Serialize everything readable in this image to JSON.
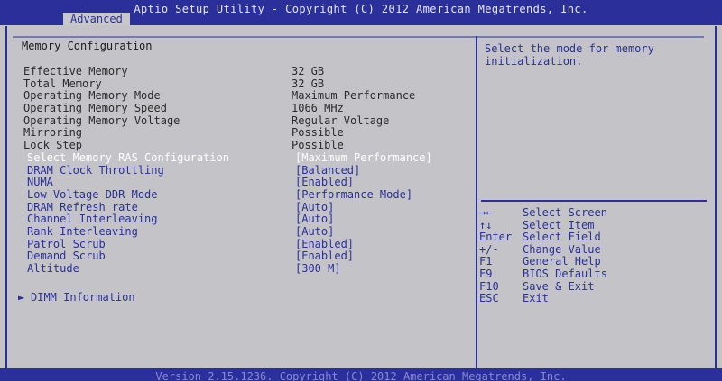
{
  "header": {
    "title": "Aptio Setup Utility - Copyright (C) 2012 American Megatrends, Inc.",
    "active_tab": "Advanced"
  },
  "main": {
    "section_title": "Memory Configuration",
    "rows": [
      {
        "label": "Effective Memory",
        "value": "32 GB"
      },
      {
        "label": "Total Memory",
        "value": "32 GB"
      },
      {
        "label": "Operating Memory Mode",
        "value": "Maximum Performance"
      },
      {
        "label": "Operating Memory Speed",
        "value": "1066 MHz"
      },
      {
        "label": "Operating Memory Voltage",
        "value": "Regular Voltage"
      },
      {
        "label": "Mirroring",
        "value": "Possible"
      },
      {
        "label": "Lock Step",
        "value": "Possible"
      },
      {
        "label": "Select Memory RAS Configuration",
        "value": "[Maximum Performance]"
      },
      {
        "label": "DRAM Clock Throttling",
        "value": "[Balanced]"
      },
      {
        "label": "NUMA",
        "value": "[Enabled]"
      },
      {
        "label": "Low Voltage DDR Mode",
        "value": "[Performance Mode]"
      },
      {
        "label": "DRAM Refresh rate",
        "value": "[Auto]"
      },
      {
        "label": "Channel Interleaving",
        "value": "[Auto]"
      },
      {
        "label": "Rank Interleaving",
        "value": "[Auto]"
      },
      {
        "label": "Patrol Scrub",
        "value": "[Enabled]"
      },
      {
        "label": "Demand Scrub",
        "value": "[Enabled]"
      },
      {
        "label": "Altitude",
        "value": "[300 M]"
      }
    ],
    "submenu": {
      "arrow": "►",
      "label": "DIMM Information"
    }
  },
  "help": {
    "text": "Select the mode for memory initialization.",
    "keys": [
      {
        "key": "→←",
        "desc": "Select Screen"
      },
      {
        "key": "↑↓",
        "desc": "Select Item"
      },
      {
        "key": "Enter",
        "desc": "Select Field"
      },
      {
        "key": "+/-",
        "desc": "Change Value"
      },
      {
        "key": "F1",
        "desc": "General Help"
      },
      {
        "key": "F9",
        "desc": "BIOS Defaults"
      },
      {
        "key": "F10",
        "desc": "Save & Exit"
      },
      {
        "key": "ESC",
        "desc": "Exit"
      }
    ]
  },
  "footer": {
    "text": "Version 2.15.1236. Copyright (C) 2012 American Megatrends, Inc."
  },
  "colors": {
    "header_bg": "#2a2f9a",
    "panel_bg": "#c4c4c8",
    "option_text": "#2a2f9a",
    "selected_text": "#ffffff"
  }
}
